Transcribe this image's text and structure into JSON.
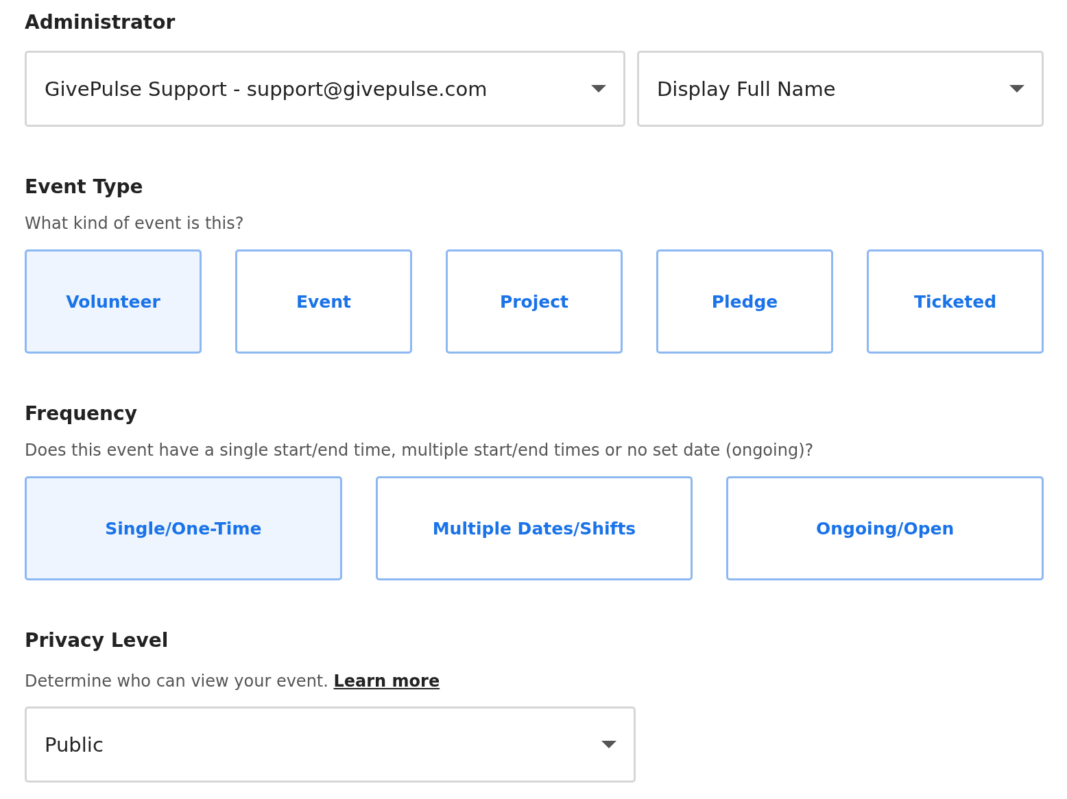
{
  "administrator": {
    "heading": "Administrator",
    "selects": [
      {
        "value": "GivePulse Support - support@givepulse.com"
      },
      {
        "value": "Display Full Name"
      }
    ]
  },
  "event_type": {
    "heading": "Event Type",
    "description": "What kind of event is this?",
    "options": [
      {
        "label": "Volunteer",
        "selected": true
      },
      {
        "label": "Event",
        "selected": false
      },
      {
        "label": "Project",
        "selected": false
      },
      {
        "label": "Pledge",
        "selected": false
      },
      {
        "label": "Ticketed",
        "selected": false
      }
    ]
  },
  "frequency": {
    "heading": "Frequency",
    "description": "Does this event have a single start/end time, multiple start/end times or no set date (ongoing)?",
    "options": [
      {
        "label": "Single/One-Time",
        "selected": true
      },
      {
        "label": "Multiple Dates/Shifts",
        "selected": false
      },
      {
        "label": "Ongoing/Open",
        "selected": false
      }
    ]
  },
  "privacy": {
    "heading": "Privacy Level",
    "description": "Determine who can view your event.",
    "link": "Learn more",
    "select": {
      "value": "Public"
    }
  }
}
